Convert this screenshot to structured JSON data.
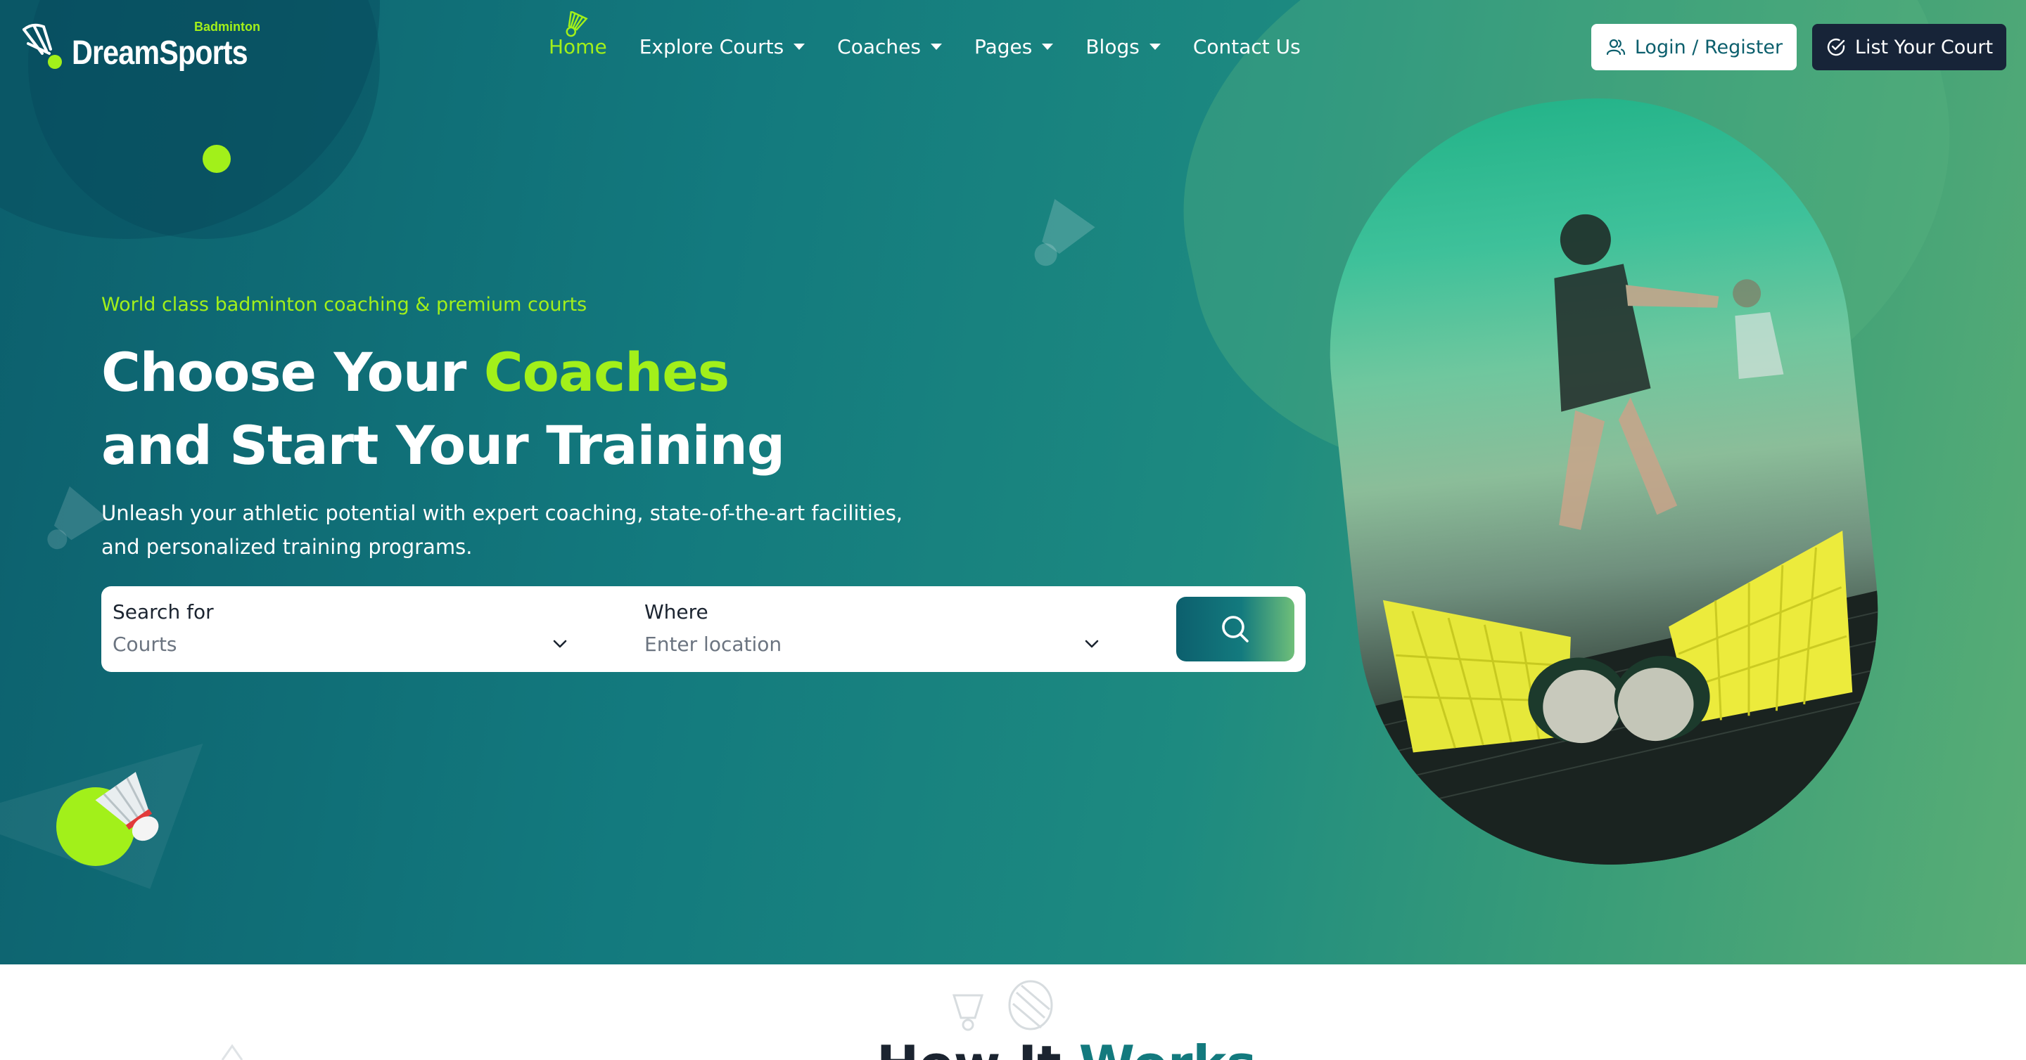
{
  "brand": {
    "name": "DreamSports",
    "sub": "Badminton",
    "accent": "#a2f01a",
    "primary": "#137a7e",
    "dark": "#172438"
  },
  "nav": {
    "items": [
      {
        "label": "Home",
        "active": true
      },
      {
        "label": "Explore Courts",
        "dropdown": true
      },
      {
        "label": "Coaches",
        "dropdown": true
      },
      {
        "label": "Pages",
        "dropdown": true
      },
      {
        "label": "Blogs",
        "dropdown": true
      },
      {
        "label": "Contact Us"
      }
    ]
  },
  "header": {
    "login_label": "Login / Register",
    "list_label": "List Your Court",
    "login_icon": "users-icon",
    "list_icon": "check-circle-icon"
  },
  "hero": {
    "eyebrow": "World class badminton coaching & premium courts",
    "headline_line1_a": "Choose Your ",
    "headline_line1_b": "Coaches",
    "headline_line2": "and Start Your Training",
    "subtitle": "Unleash your athletic potential with expert coaching, state-of-the-art facilities, and personalized training programs."
  },
  "search": {
    "field1_label": "Search for",
    "field1_value": "Courts",
    "field2_label": "Where",
    "field2_placeholder": "Enter location",
    "button_icon": "search-icon"
  },
  "how": {
    "title_a": "How It ",
    "title_b": "Works"
  }
}
